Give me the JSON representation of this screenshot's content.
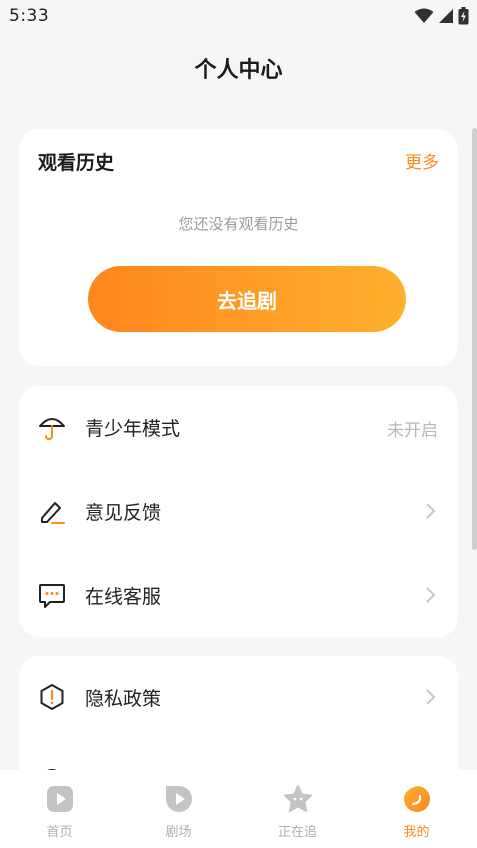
{
  "status_bar": {
    "time": "5:33"
  },
  "header": {
    "title": "个人中心"
  },
  "history": {
    "title": "观看历史",
    "more": "更多",
    "empty_text": "您还没有观看历史",
    "button": "去追剧"
  },
  "menu": [
    {
      "label": "青少年模式",
      "value": "未开启",
      "icon": "umbrella-icon"
    },
    {
      "label": "意见反馈",
      "icon": "pencil-icon"
    },
    {
      "label": "在线客服",
      "icon": "chat-icon"
    }
  ],
  "menu2": [
    {
      "label": "隐私政策",
      "icon": "shield-alert-icon"
    }
  ],
  "tabs": [
    {
      "label": "首页",
      "icon": "home-play-icon",
      "active": false
    },
    {
      "label": "剧场",
      "icon": "theater-play-icon",
      "active": false
    },
    {
      "label": "正在追",
      "icon": "star-icon",
      "active": false
    },
    {
      "label": "我的",
      "icon": "profile-icon",
      "active": true
    }
  ],
  "colors": {
    "accent": "#ff8a1e",
    "gradient_start": "#ff861e",
    "gradient_end": "#ffb02e"
  }
}
